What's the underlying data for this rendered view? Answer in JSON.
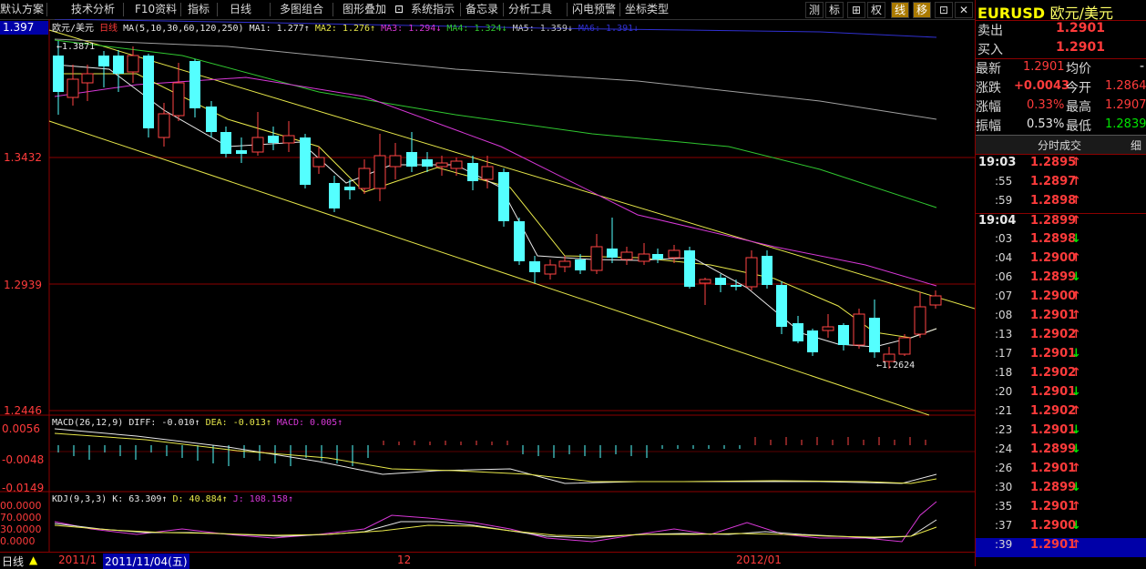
{
  "toolbar": {
    "items": [
      "默认方案",
      "技术分析",
      "F10资料",
      "指标",
      "日线",
      "多图组合",
      "图形叠加",
      "系统指示",
      "备忘录",
      "分析工具",
      "闪电预警",
      "坐标类型"
    ],
    "right_buttons": [
      "测",
      "标",
      "⊞",
      "权",
      "线",
      "移",
      "⊡",
      "✕"
    ]
  },
  "chart": {
    "current_price_box": "1.397",
    "y_labels": [
      "1.3432",
      "1.2939",
      "1.2446"
    ],
    "ma_legend": {
      "title": "欧元/美元",
      "period": "日线",
      "spec": "MA(5,10,30,60,120,250)",
      "ma1": "MA1: 1.277↑",
      "ma2": "MA2: 1.276↑",
      "ma3": "MA3: 1.294↓",
      "ma4": "MA4: 1.324↓",
      "ma5": "MA5: 1.359↓",
      "ma6": "MA6: 1.391↓"
    },
    "high_annotation": "←1.3871",
    "low_annotation": "←1.2624",
    "macd": {
      "legend_spec": "MACD(26,12,9)",
      "diff": "DIFF: -0.010↑",
      "dea": "DEA: -0.013↑",
      "macd": "MACD: 0.005↑",
      "y_labels": [
        "0.0056",
        "-0.0048",
        "-0.0149"
      ]
    },
    "kdj": {
      "legend_spec": "KDJ(9,3,3)",
      "k": "K: 63.309↑",
      "d": "D: 40.884↑",
      "j": "J: 108.158↑",
      "y_labels": [
        "00.0000",
        "70.0000",
        "30.0000",
        "0.0000"
      ]
    },
    "dates": [
      "2011/1",
      "2011/11/04(五)",
      "12",
      "2012/01"
    ],
    "period_label": "日线"
  },
  "panel": {
    "symbol": "EURUSD",
    "name": "欧元/美元",
    "quote": [
      {
        "label": "卖出",
        "value": "1.2901"
      },
      {
        "label": "买入",
        "value": "1.2901"
      }
    ],
    "stats": [
      {
        "l1": "最新",
        "v1": "1.2901",
        "l2": "均价",
        "v2": "-"
      },
      {
        "l1": "涨跌",
        "v1": "+0.0043",
        "l2": "今开",
        "v2": "1.2864"
      },
      {
        "l1": "涨幅",
        "v1": "0.33%",
        "l2": "最高",
        "v2": "1.2907"
      },
      {
        "l1": "振幅",
        "v1": "0.53%",
        "l2": "最低",
        "v2": "1.2839"
      }
    ],
    "ticks_header": "分时成交",
    "ticks_header_right": "细",
    "ticks": [
      {
        "time": "19:03",
        "price": "1.2895",
        "dir": "up",
        "bold": true
      },
      {
        "time": ":55",
        "price": "1.2897",
        "dir": "up"
      },
      {
        "time": ":59",
        "price": "1.2898",
        "dir": "up"
      },
      {
        "time": "19:04",
        "price": "1.2899",
        "dir": "up",
        "bold": true
      },
      {
        "time": ":03",
        "price": "1.2898",
        "dir": "down"
      },
      {
        "time": ":04",
        "price": "1.2900",
        "dir": "up"
      },
      {
        "time": ":06",
        "price": "1.2899",
        "dir": "down"
      },
      {
        "time": ":07",
        "price": "1.2900",
        "dir": "up"
      },
      {
        "time": ":08",
        "price": "1.2901",
        "dir": "up"
      },
      {
        "time": ":13",
        "price": "1.2902",
        "dir": "up"
      },
      {
        "time": ":17",
        "price": "1.2901",
        "dir": "down"
      },
      {
        "time": ":18",
        "price": "1.2902",
        "dir": "up"
      },
      {
        "time": ":20",
        "price": "1.2901",
        "dir": "down"
      },
      {
        "time": ":21",
        "price": "1.2902",
        "dir": "up"
      },
      {
        "time": ":23",
        "price": "1.2901",
        "dir": "down"
      },
      {
        "time": ":24",
        "price": "1.2899",
        "dir": "down"
      },
      {
        "time": ":26",
        "price": "1.2901",
        "dir": "up"
      },
      {
        "time": ":30",
        "price": "1.2899",
        "dir": "down"
      },
      {
        "time": ":35",
        "price": "1.2901",
        "dir": "up"
      },
      {
        "time": ":37",
        "price": "1.2900",
        "dir": "down"
      },
      {
        "time": ":39",
        "price": "1.2901",
        "dir": "up"
      }
    ]
  },
  "colors": {
    "up_candle": "#ff4444",
    "down_candle": "#54ffff",
    "ma_white": "#e8e8e8",
    "ma_yellow": "#e8e84a",
    "ma_magenta": "#d838d8",
    "ma_green": "#30c830",
    "ma_gray": "#a0a0a0",
    "ma_blue": "#3030d0"
  }
}
